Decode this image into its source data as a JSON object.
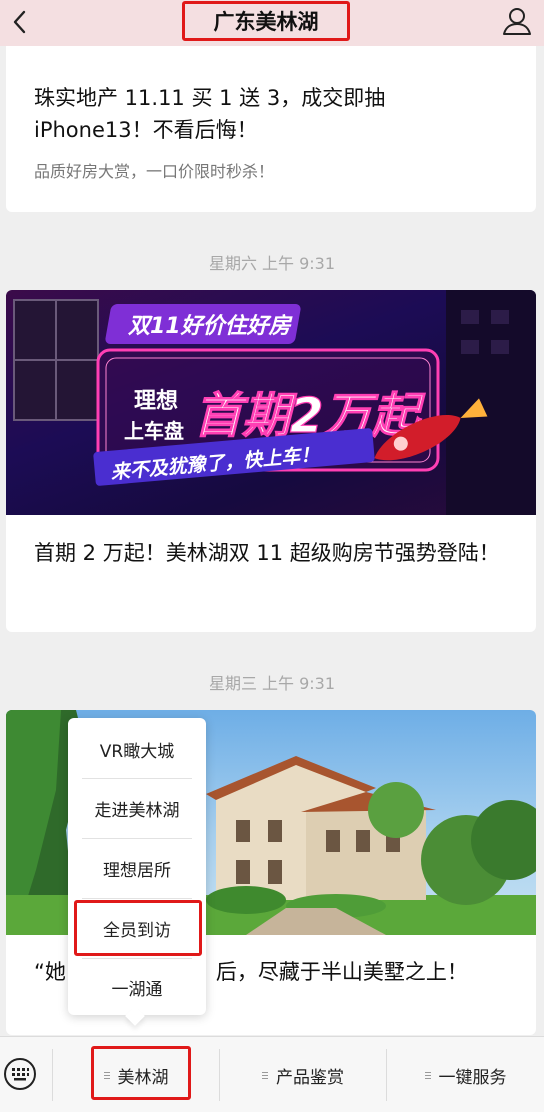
{
  "header": {
    "title": "广东美林湖",
    "back_icon": "chevron-left-icon",
    "profile_icon": "person-icon"
  },
  "messages": [
    {
      "title": "珠实地产 11.11 买 1 送 3，成交即抽 iPhone13！不看后悔！",
      "subtitle": "品质好房大赏，一口价限时秒杀！"
    },
    {
      "timestamp": "星期六 上午 9:31",
      "banner": {
        "top_text": "双11好价住好房",
        "left_text_1": "理想",
        "left_text_2": "上车盘",
        "main_text": "首期2万起",
        "bottom_text": "来不及犹豫了，快上车！"
      },
      "title": "首期 2 万起！美林湖双 11 超级购房节强势登陆！"
    },
    {
      "timestamp": "星期三 上午 9:31",
      "title_prefix": "“她",
      "title_suffix": "后，尽藏于半山美墅之上！"
    }
  ],
  "popup_menu": {
    "items": [
      "VR瞰大城",
      "走进美林湖",
      "理想居所",
      "全员到访",
      "一湖通"
    ],
    "highlighted_index": 3
  },
  "bottom_bar": {
    "keyboard_icon": "keyboard-icon",
    "tabs": [
      "美林湖",
      "产品鉴赏",
      "一键服务"
    ],
    "highlighted_index": 0
  },
  "colors": {
    "highlight": "#e01919",
    "header_bg": "#f4dfe1",
    "neon_pink": "#ff3fb4"
  }
}
